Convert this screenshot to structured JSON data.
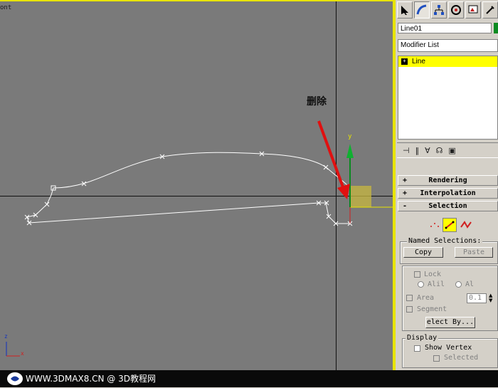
{
  "viewport": {
    "label": "ont"
  },
  "annotation": {
    "text": "删除"
  },
  "gizmo": {
    "y_label": "y"
  },
  "axis_tripod": {
    "z": "z",
    "x": "x"
  },
  "panel": {
    "tabs": [
      "create-icon",
      "modify-icon",
      "hierarchy-icon",
      "motion-icon",
      "display-icon",
      "utilities-icon"
    ],
    "object_name": "Line01",
    "object_color": "#0a8a20",
    "modifier_list": "Modifier List",
    "stack": [
      {
        "label": "Line"
      }
    ],
    "rollouts": {
      "rendering": {
        "sign": "+",
        "title": "Rendering"
      },
      "interpolation": {
        "sign": "+",
        "title": "Interpolation"
      },
      "selection": {
        "sign": "-",
        "title": "Selection"
      }
    },
    "named_selections": {
      "title": "Named Selections:",
      "copy": "Copy",
      "paste": "Paste"
    },
    "lock": {
      "label": "Lock",
      "opt1": "Alil",
      "opt2": "Al"
    },
    "area": {
      "label": "Area",
      "value": "0.1"
    },
    "segment": {
      "label": "Segment"
    },
    "select_by": "elect By...",
    "display": {
      "title": "Display",
      "show_vertex": "Show Vertex",
      "selected": "Selected"
    }
  },
  "footer": {
    "text": "WWW.3DMAX8.CN @ 3D教程网"
  }
}
